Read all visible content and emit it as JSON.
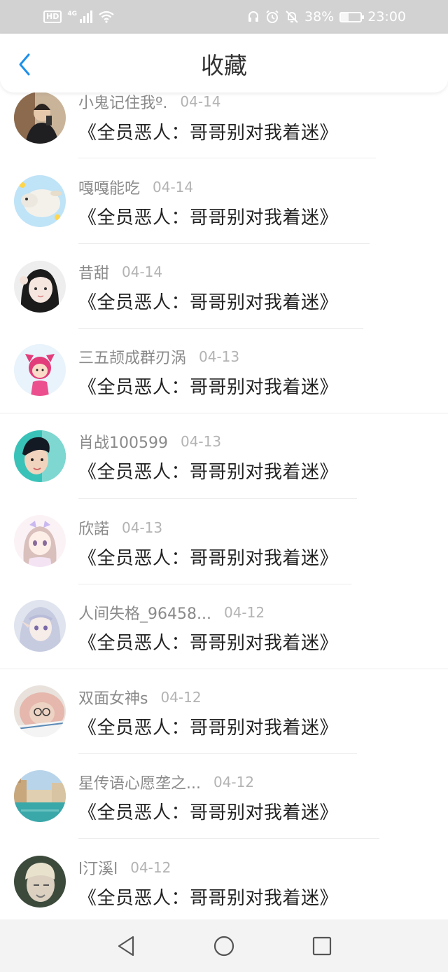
{
  "status_bar": {
    "hd": "HD",
    "network": "4G",
    "battery": "38%",
    "time": "23:00",
    "icons": [
      "signal-icon",
      "wifi-icon",
      "headphones-icon",
      "alarm-icon",
      "mute-icon",
      "battery-icon"
    ]
  },
  "header": {
    "title": "收藏",
    "back_icon": "chevron-left-icon"
  },
  "colors": {
    "accent": "#1e90e8",
    "status_bar_bg": "#d2d2d2",
    "nav_bar_bg": "#f3f3f3"
  },
  "favorites": [
    {
      "user": "小鬼记住我º.",
      "date": "04-14",
      "book": "《全员恶人：哥哥别对我着迷》",
      "avatar": "user-photo-avatar"
    },
    {
      "user": "嘎嘎能吃",
      "date": "04-14",
      "book": "《全员恶人：哥哥别对我着迷》",
      "avatar": "sheep-avatar"
    },
    {
      "user": "昔甜",
      "date": "04-14",
      "book": "《全员恶人：哥哥别对我着迷》",
      "avatar": "girl-photo-avatar"
    },
    {
      "user": "三五颉成群刃涡",
      "date": "04-13",
      "book": "《全员恶人：哥哥别对我着迷》",
      "avatar": "cartoon-girl-avatar"
    },
    {
      "user": "肖战100599",
      "date": "04-13",
      "book": "《全员恶人：哥哥别对我着迷》",
      "avatar": "man-photo-avatar"
    },
    {
      "user": "欣諾",
      "date": "04-13",
      "book": "《全员恶人：哥哥别对我着迷》",
      "avatar": "anime-girl-avatar"
    },
    {
      "user": "人间失格_96458...",
      "date": "04-12",
      "book": "《全员恶人：哥哥别对我着迷》",
      "avatar": "anime-elf-avatar"
    },
    {
      "user": "双面女神s",
      "date": "04-12",
      "book": "《全员恶人：哥哥别对我着迷》",
      "avatar": "hooded-person-avatar"
    },
    {
      "user": "星传语心愿垄之...",
      "date": "04-12",
      "book": "《全员恶人：哥哥别对我着迷》",
      "avatar": "venice-canal-avatar"
    },
    {
      "user": "l汀溪l",
      "date": "04-12",
      "book": "《全员恶人：哥哥别对我着迷》",
      "avatar": "blond-man-avatar"
    }
  ],
  "nav_bar": {
    "icons": [
      "back-triangle-icon",
      "home-circle-icon",
      "recents-square-icon"
    ]
  }
}
